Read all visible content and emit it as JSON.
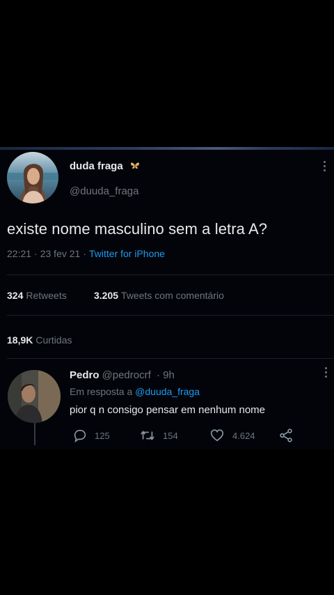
{
  "tweet": {
    "author_name": "duda fraga",
    "author_handle": "@duuda_fraga",
    "text": "existe nome masculino sem a letra A?",
    "time": "22:21",
    "date": "23 fev 21",
    "separator": "·",
    "source": "Twitter for iPhone",
    "retweets_count": "324",
    "retweets_label": "Retweets",
    "quote_count": "3.205",
    "quote_label": "Tweets com comentário",
    "likes_count": "18,9K",
    "likes_label": "Curtidas"
  },
  "reply": {
    "author_name": "Pedro",
    "author_handle": "@pedrocrf",
    "age": "· 9h",
    "replying_prefix": "Em resposta a",
    "replying_to": "@duuda_fraga",
    "text": "pior q n consigo pensar em nenhum nome",
    "reply_count": "125",
    "retweet_count": "154",
    "like_count": "4.624"
  },
  "colors": {
    "background": "#000000",
    "text_primary": "#e7e9ea",
    "text_secondary": "#6e767d",
    "accent": "#1d9bf0"
  },
  "icons": {
    "butterfly": "butterfly-emoji-icon",
    "more": "more-vertical-icon",
    "reply": "reply-icon",
    "retweet": "retweet-icon",
    "like": "heart-icon",
    "share": "share-icon"
  }
}
